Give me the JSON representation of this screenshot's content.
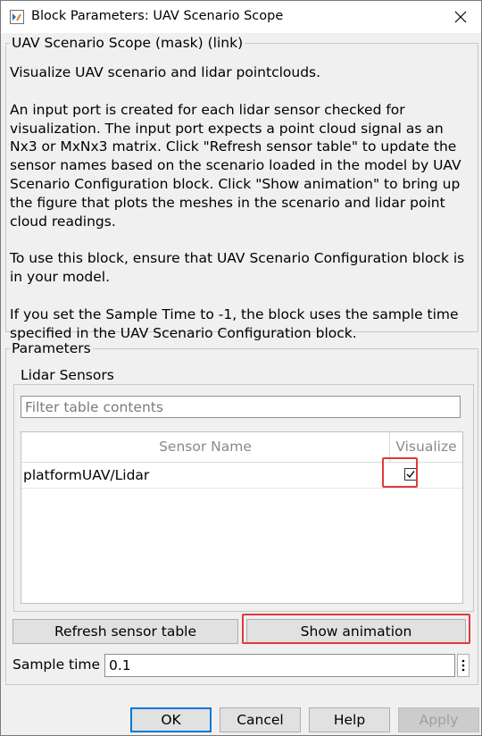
{
  "window": {
    "title": "Block Parameters: UAV Scenario Scope",
    "app_icon": "simulink-block-icon",
    "close_icon": "close-icon"
  },
  "mask_group": {
    "legend": "UAV Scenario Scope (mask) (link)",
    "paragraphs": [
      "Visualize UAV scenario and lidar pointclouds.",
      "An input port is created for each lidar sensor checked for visualization. The input port expects a point cloud signal as an Nx3 or MxNx3 matrix. Click \"Refresh sensor table\" to update the sensor names based on the scenario loaded in the model by UAV Scenario Configuration block. Click \"Show animation\" to bring up the figure that plots the meshes in the scenario and lidar point cloud readings.",
      "To use this block, ensure that UAV Scenario Configuration block is in your model.",
      "If you set the Sample Time to -1, the block uses the sample time specified in the UAV Scenario Configuration block."
    ]
  },
  "parameters": {
    "legend": "Parameters",
    "lidar": {
      "legend": "Lidar Sensors",
      "filter_placeholder": "Filter table contents",
      "filter_value": "",
      "columns": [
        "Sensor Name",
        "Visualize"
      ],
      "rows": [
        {
          "sensor_name": "platformUAV/Lidar",
          "visualize": true
        }
      ]
    },
    "refresh_label": "Refresh sensor table",
    "show_animation_label": "Show animation",
    "sample_time_label": "Sample time",
    "sample_time_value": "0.1",
    "more_icon": "vertical-ellipsis-icon"
  },
  "buttons": {
    "ok": "OK",
    "cancel": "Cancel",
    "help": "Help",
    "apply": "Apply"
  },
  "colors": {
    "highlight": "#e0393e",
    "focus": "#0078d7"
  }
}
